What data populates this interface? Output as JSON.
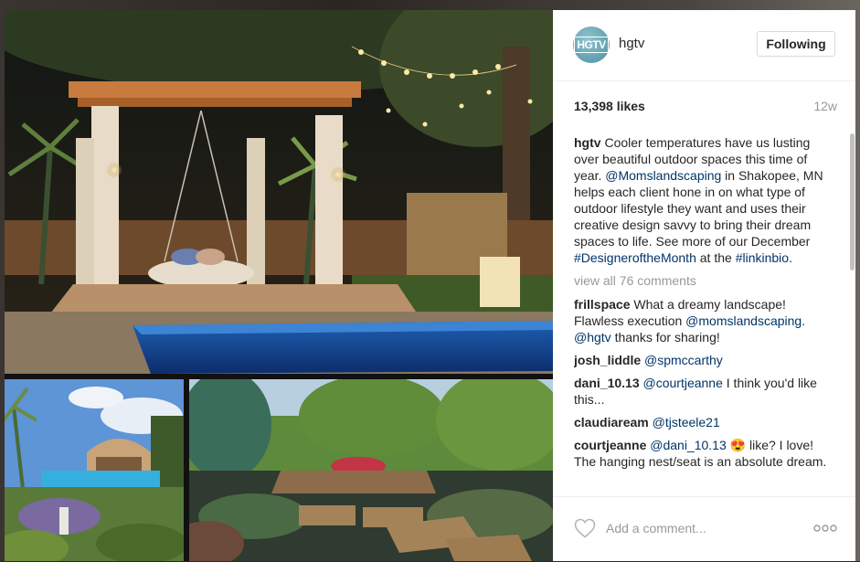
{
  "post": {
    "username": "hgtv",
    "avatar_text": "HGTV",
    "follow_label": "Following",
    "likes": "13,398 likes",
    "age": "12w",
    "caption": {
      "user": "hgtv",
      "part1": " Cooler temperatures have us lusting over beautiful outdoor spaces this time of year. ",
      "mention": "@Momslandscaping",
      "part2": " in Shakopee, MN helps each client hone in on what type of outdoor lifestyle they want and uses their creative design savvy to bring their dream spaces to life. See more of our December ",
      "hashtag": "#DesigneroftheMonth",
      "part3": " at the ",
      "link": "#linkinbio",
      "part4": "."
    },
    "view_all": "view all 76 comments",
    "comments": [
      {
        "user": "frillspace",
        "t1": " What a dreamy landscape! Flawless execution ",
        "m1": "@momslandscaping",
        "t2": ". ",
        "m2": "@hgtv",
        "t3": " thanks for sharing!"
      },
      {
        "user": "josh_liddle",
        "t1": " ",
        "m1": "@spmccarthy",
        "t2": "",
        "m2": "",
        "t3": ""
      },
      {
        "user": "dani_10.13",
        "t1": " ",
        "m1": "@courtjeanne",
        "t2": " I think you'd like this...",
        "m2": "",
        "t3": ""
      },
      {
        "user": "claudiaream",
        "t1": " ",
        "m1": "@tjsteele21",
        "t2": "",
        "m2": "",
        "t3": ""
      },
      {
        "user": "courtjeanne",
        "t1": " ",
        "m1": "@dani_10.13",
        "t2": " 😍 like? I love! The hanging nest/seat is an absolute dream.",
        "m2": "",
        "t3": ""
      }
    ],
    "comment_placeholder": "Add a comment...",
    "icons": {
      "like": "heart-icon",
      "more": "more-options-icon"
    }
  },
  "colors": {
    "link": "#003569",
    "muted": "#999999",
    "text": "#262626"
  }
}
